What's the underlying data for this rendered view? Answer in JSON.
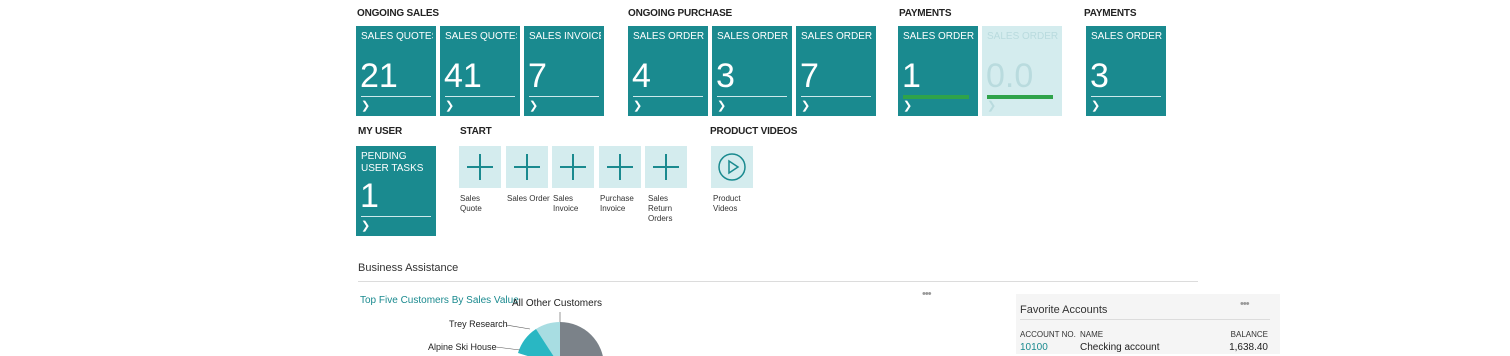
{
  "groups": {
    "ongoing_sales": "ONGOING SALES",
    "ongoing_purchase": "ONGOING PURCHASE",
    "payments_1": "PAYMENTS",
    "payments_2": "PAYMENTS",
    "my_user": "MY USER",
    "start": "START",
    "product_videos": "PRODUCT VIDEOS"
  },
  "tiles": [
    {
      "label": "SALES QUOTES",
      "value": "21"
    },
    {
      "label": "SALES QUOTES",
      "value": "41"
    },
    {
      "label": "SALES INVOICES",
      "value": "7"
    },
    {
      "label": "SALES ORDER",
      "value": "4"
    },
    {
      "label": "SALES ORDER",
      "value": "3"
    },
    {
      "label": "SALES ORDER",
      "value": "7"
    },
    {
      "label": "SALES ORDER",
      "value": "1"
    },
    {
      "label": "SALES ORDER",
      "value": "0.0"
    },
    {
      "label": "SALES ORDER",
      "value": "3"
    }
  ],
  "user_tile": {
    "label": "PENDING USER TASKS",
    "value": "1"
  },
  "start_actions": [
    {
      "label": "Sales Quote"
    },
    {
      "label": "Sales Order"
    },
    {
      "label": "Sales Invoice"
    },
    {
      "label": "Purchase Invoice"
    },
    {
      "label": "Sales Return Orders"
    }
  ],
  "video": {
    "label": "Product Videos"
  },
  "business_assistance": {
    "title": "Business Assistance"
  },
  "chart": {
    "title": "Top Five Customers By Sales Value",
    "menu": "•••",
    "labels": [
      "All Other Customers",
      "Trey Research",
      "Alpine Ski House"
    ],
    "colors": {
      "other": "#7b8289",
      "slice1": "#a8dde2",
      "slice2": "#29b7c3"
    }
  },
  "favorite_accounts": {
    "title": "Favorite Accounts",
    "menu": "•••",
    "headers": [
      "ACCOUNT NO.",
      "NAME",
      "BALANCE"
    ],
    "rows": [
      {
        "no": "10100",
        "name": "Checking account",
        "balance": "1,638.40"
      }
    ]
  },
  "colors": {
    "accent": "#1a8a8f",
    "light": "#d4ecee",
    "bar": "#2fa34a"
  }
}
